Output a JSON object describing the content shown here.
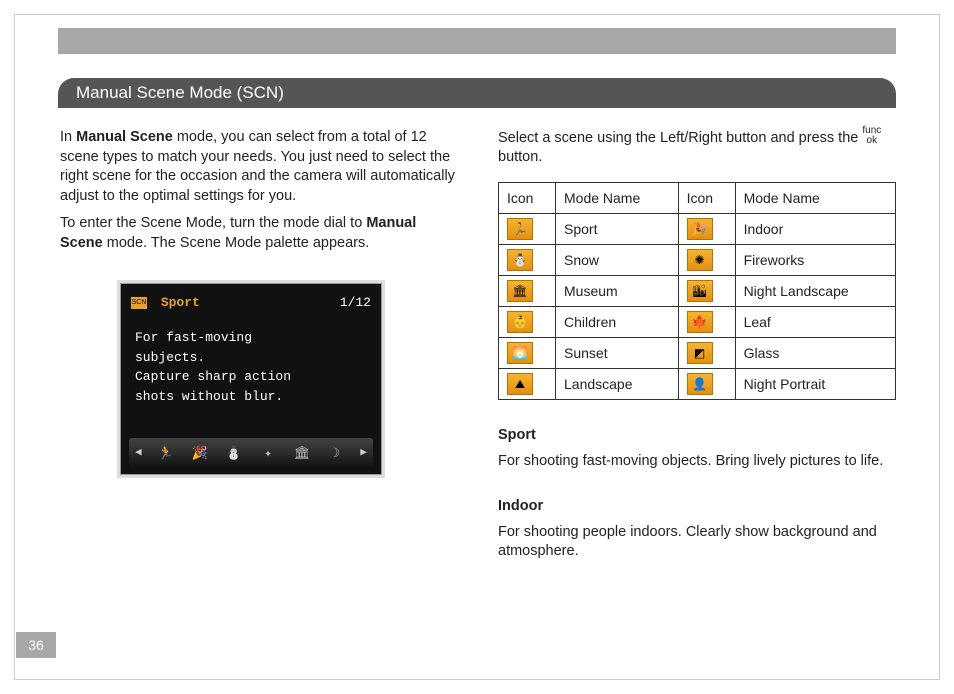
{
  "page_number": "36",
  "title": "Manual Scene Mode (SCN)",
  "left": {
    "p1a": "In ",
    "p1b": "Manual Scene",
    "p1c": " mode, you can select from a total of 12 scene types to match your needs. You just need to select the right scene for the occasion and the camera will automatically adjust to the optimal settings for you.",
    "p2a": "To enter the Scene Mode, turn the mode dial to ",
    "p2b": "Manual Scene",
    "p2c": " mode. The Scene Mode palette appears.",
    "lcd": {
      "badge": "SCN",
      "mode": "Sport",
      "counter": "1/12",
      "desc_l1": "For fast-moving",
      "desc_l2": "subjects.",
      "desc_l3": "Capture sharp action",
      "desc_l4": "shots without blur.",
      "thumbs": [
        "◀",
        "🏃",
        "🎉",
        "⛄",
        "✦",
        "🏛",
        "☽",
        "▶"
      ]
    }
  },
  "right": {
    "intro_a": "Select a scene using the Left/Right button and press the ",
    "intro_b": " button.",
    "func_top": "func",
    "func_bot": "ok",
    "table_headers": {
      "icon": "Icon",
      "name": "Mode Name"
    },
    "rows": [
      {
        "i1": "🏃",
        "n1": "Sport",
        "i2": "🎉",
        "n2": "Indoor"
      },
      {
        "i1": "⛄",
        "n1": "Snow",
        "i2": "✺",
        "n2": "Fireworks"
      },
      {
        "i1": "🏛",
        "n1": "Museum",
        "i2": "🏙",
        "n2": "Night Landscape"
      },
      {
        "i1": "👶",
        "n1": "Children",
        "i2": "🍁",
        "n2": "Leaf"
      },
      {
        "i1": "🌅",
        "n1": "Sunset",
        "i2": "◩",
        "n2": "Glass"
      },
      {
        "i1": "⛰",
        "n1": "Landscape",
        "i2": "👤",
        "n2": "Night Portrait"
      }
    ],
    "sport_h": "Sport",
    "sport_d": "For shooting fast-moving objects. Bring lively pictures to life.",
    "indoor_h": "Indoor",
    "indoor_d": "For shooting people indoors. Clearly show background and atmosphere."
  }
}
